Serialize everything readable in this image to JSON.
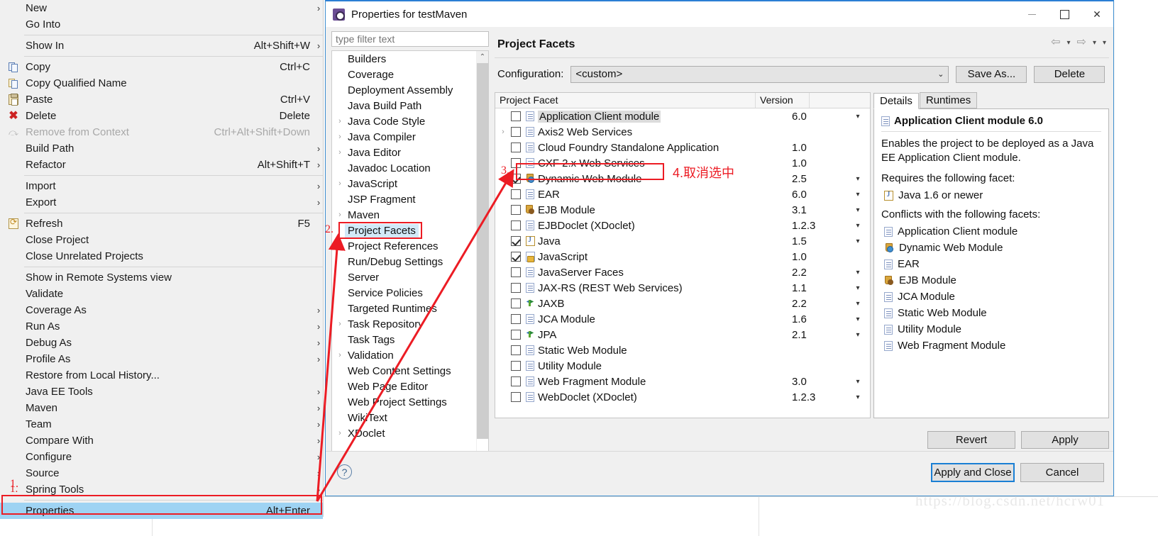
{
  "context_menu": {
    "groups": [
      {
        "items": [
          {
            "label": "New",
            "accel": "",
            "submenu": true,
            "icon": ""
          },
          {
            "label": "Go Into",
            "accel": "",
            "submenu": false,
            "icon": ""
          }
        ]
      },
      {
        "items": [
          {
            "label": "Show In",
            "accel": "Alt+Shift+W",
            "submenu": true,
            "icon": ""
          }
        ]
      },
      {
        "items": [
          {
            "label": "Copy",
            "accel": "Ctrl+C",
            "submenu": false,
            "icon": "copy-icon"
          },
          {
            "label": "Copy Qualified Name",
            "accel": "",
            "submenu": false,
            "icon": "copy-qualified-icon"
          },
          {
            "label": "Paste",
            "accel": "Ctrl+V",
            "submenu": false,
            "icon": "paste-icon"
          },
          {
            "label": "Delete",
            "accel": "Delete",
            "submenu": false,
            "icon": "delete-icon"
          },
          {
            "label": "Remove from Context",
            "accel": "Ctrl+Alt+Shift+Down",
            "submenu": false,
            "icon": "remove-context-icon",
            "disabled": true
          },
          {
            "label": "Build Path",
            "accel": "",
            "submenu": true,
            "icon": ""
          },
          {
            "label": "Refactor",
            "accel": "Alt+Shift+T",
            "submenu": true,
            "icon": ""
          }
        ]
      },
      {
        "items": [
          {
            "label": "Import",
            "accel": "",
            "submenu": true,
            "icon": ""
          },
          {
            "label": "Export",
            "accel": "",
            "submenu": true,
            "icon": ""
          }
        ]
      },
      {
        "items": [
          {
            "label": "Refresh",
            "accel": "F5",
            "submenu": false,
            "icon": "refresh-icon"
          },
          {
            "label": "Close Project",
            "accel": "",
            "submenu": false,
            "icon": ""
          },
          {
            "label": "Close Unrelated Projects",
            "accel": "",
            "submenu": false,
            "icon": ""
          }
        ]
      },
      {
        "items": [
          {
            "label": "Show in Remote Systems view",
            "accel": "",
            "submenu": false,
            "icon": ""
          },
          {
            "label": "Validate",
            "accel": "",
            "submenu": false,
            "icon": ""
          },
          {
            "label": "Coverage As",
            "accel": "",
            "submenu": true,
            "icon": ""
          },
          {
            "label": "Run As",
            "accel": "",
            "submenu": true,
            "icon": ""
          },
          {
            "label": "Debug As",
            "accel": "",
            "submenu": true,
            "icon": ""
          },
          {
            "label": "Profile As",
            "accel": "",
            "submenu": true,
            "icon": ""
          },
          {
            "label": "Restore from Local History...",
            "accel": "",
            "submenu": false,
            "icon": ""
          },
          {
            "label": "Java EE Tools",
            "accel": "",
            "submenu": true,
            "icon": ""
          },
          {
            "label": "Maven",
            "accel": "",
            "submenu": true,
            "icon": ""
          },
          {
            "label": "Team",
            "accel": "",
            "submenu": true,
            "icon": ""
          },
          {
            "label": "Compare With",
            "accel": "",
            "submenu": true,
            "icon": ""
          },
          {
            "label": "Configure",
            "accel": "",
            "submenu": true,
            "icon": ""
          },
          {
            "label": "Source",
            "accel": "",
            "submenu": true,
            "icon": ""
          },
          {
            "label": "Spring Tools",
            "accel": "",
            "submenu": true,
            "icon": "",
            "annotation": "1."
          }
        ]
      },
      {
        "items": [
          {
            "label": "Properties",
            "accel": "Alt+Enter",
            "submenu": false,
            "icon": "",
            "selected": true
          }
        ]
      }
    ]
  },
  "dialog": {
    "title": "Properties for testMaven",
    "window_controls": {
      "minimize": "−",
      "maximize": "□",
      "close": "✕"
    },
    "filter": {
      "placeholder": "type filter text",
      "value": ""
    },
    "tree": [
      {
        "label": "Builders",
        "expandable": false
      },
      {
        "label": "Coverage",
        "expandable": false
      },
      {
        "label": "Deployment Assembly",
        "expandable": false
      },
      {
        "label": "Java Build Path",
        "expandable": false
      },
      {
        "label": "Java Code Style",
        "expandable": true
      },
      {
        "label": "Java Compiler",
        "expandable": true
      },
      {
        "label": "Java Editor",
        "expandable": true
      },
      {
        "label": "Javadoc Location",
        "expandable": false
      },
      {
        "label": "JavaScript",
        "expandable": true
      },
      {
        "label": "JSP Fragment",
        "expandable": false
      },
      {
        "label": "Maven",
        "expandable": true
      },
      {
        "label": "Project Facets",
        "expandable": false,
        "selected": true,
        "annotation": "2."
      },
      {
        "label": "Project References",
        "expandable": false
      },
      {
        "label": "Run/Debug Settings",
        "expandable": false
      },
      {
        "label": "Server",
        "expandable": false
      },
      {
        "label": "Service Policies",
        "expandable": false
      },
      {
        "label": "Targeted Runtimes",
        "expandable": false
      },
      {
        "label": "Task Repository",
        "expandable": true
      },
      {
        "label": "Task Tags",
        "expandable": false
      },
      {
        "label": "Validation",
        "expandable": true
      },
      {
        "label": "Web Content Settings",
        "expandable": false
      },
      {
        "label": "Web Page Editor",
        "expandable": false
      },
      {
        "label": "Web Project Settings",
        "expandable": false
      },
      {
        "label": "WikiText",
        "expandable": false
      },
      {
        "label": "XDoclet",
        "expandable": true
      }
    ],
    "page": {
      "title": "Project Facets",
      "nav": {
        "back": "⇦",
        "back_menu": "▾",
        "forward": "⇨",
        "forward_menu": "▾",
        "view_menu": "▾"
      }
    },
    "configuration": {
      "label": "Configuration:",
      "value": "<custom>",
      "save_as_label": "Save As...",
      "delete_label": "Delete"
    },
    "facet_table": {
      "columns": [
        "Project Facet",
        "Version",
        ""
      ],
      "rows": [
        {
          "checked": false,
          "expandable": false,
          "icon": "doc-icon",
          "name": "Application Client module",
          "version": "6.0",
          "has_version_menu": true,
          "highlighted": true
        },
        {
          "checked": false,
          "expandable": true,
          "icon": "doc-icon",
          "name": "Axis2 Web Services",
          "version": "",
          "has_version_menu": false
        },
        {
          "checked": false,
          "expandable": false,
          "icon": "doc-icon",
          "name": "Cloud Foundry Standalone Application",
          "version": "1.0",
          "has_version_menu": false
        },
        {
          "checked": false,
          "expandable": false,
          "icon": "doc-icon",
          "name": "CXF 2.x Web Services",
          "version": "1.0",
          "has_version_menu": false
        },
        {
          "checked": true,
          "expandable": false,
          "icon": "web-module-icon",
          "name": "Dynamic Web Module",
          "version": "2.5",
          "has_version_menu": true,
          "annotation": "3."
        },
        {
          "checked": false,
          "expandable": false,
          "icon": "doc-icon",
          "name": "EAR",
          "version": "6.0",
          "has_version_menu": true
        },
        {
          "checked": false,
          "expandable": false,
          "icon": "ejb-module-icon",
          "name": "EJB Module",
          "version": "3.1",
          "has_version_menu": true
        },
        {
          "checked": false,
          "expandable": false,
          "icon": "doc-icon",
          "name": "EJBDoclet (XDoclet)",
          "version": "1.2.3",
          "has_version_menu": true
        },
        {
          "checked": true,
          "expandable": false,
          "icon": "java-icon",
          "name": "Java",
          "version": "1.5",
          "has_version_menu": true
        },
        {
          "checked": true,
          "expandable": false,
          "icon": "javascript-icon",
          "name": "JavaScript",
          "version": "1.0",
          "has_version_menu": false
        },
        {
          "checked": false,
          "expandable": false,
          "icon": "doc-icon",
          "name": "JavaServer Faces",
          "version": "2.2",
          "has_version_menu": true
        },
        {
          "checked": false,
          "expandable": false,
          "icon": "doc-icon",
          "name": "JAX-RS (REST Web Services)",
          "version": "1.1",
          "has_version_menu": true
        },
        {
          "checked": false,
          "expandable": false,
          "icon": "xml-icon",
          "name": "JAXB",
          "version": "2.2",
          "has_version_menu": true
        },
        {
          "checked": false,
          "expandable": false,
          "icon": "doc-icon",
          "name": "JCA Module",
          "version": "1.6",
          "has_version_menu": true
        },
        {
          "checked": false,
          "expandable": false,
          "icon": "xml-icon",
          "name": "JPA",
          "version": "2.1",
          "has_version_menu": true
        },
        {
          "checked": false,
          "expandable": false,
          "icon": "doc-icon",
          "name": "Static Web Module",
          "version": "",
          "has_version_menu": false
        },
        {
          "checked": false,
          "expandable": false,
          "icon": "doc-icon",
          "name": "Utility Module",
          "version": "",
          "has_version_menu": false
        },
        {
          "checked": false,
          "expandable": false,
          "icon": "doc-icon",
          "name": "Web Fragment Module",
          "version": "3.0",
          "has_version_menu": true
        },
        {
          "checked": false,
          "expandable": false,
          "icon": "doc-icon",
          "name": "WebDoclet (XDoclet)",
          "version": "1.2.3",
          "has_version_menu": true
        }
      ]
    },
    "details": {
      "tabs": [
        {
          "label": "Details",
          "active": true
        },
        {
          "label": "Runtimes",
          "active": false
        }
      ],
      "facet_title": "Application Client module 6.0",
      "facet_title_icon": "doc-icon",
      "description": "Enables the project to be deployed as a Java EE Application Client module.",
      "requires_label": "Requires the following facet:",
      "requires": [
        {
          "icon": "java-icon",
          "label": "Java 1.6 or newer"
        }
      ],
      "conflicts_label": "Conflicts with the following facets:",
      "conflicts": [
        {
          "icon": "doc-icon",
          "label": "Application Client module"
        },
        {
          "icon": "web-module-icon",
          "label": "Dynamic Web Module"
        },
        {
          "icon": "doc-icon",
          "label": "EAR"
        },
        {
          "icon": "ejb-module-icon",
          "label": "EJB Module"
        },
        {
          "icon": "doc-icon",
          "label": "JCA Module"
        },
        {
          "icon": "doc-icon",
          "label": "Static Web Module"
        },
        {
          "icon": "doc-icon",
          "label": "Utility Module"
        },
        {
          "icon": "doc-icon",
          "label": "Web Fragment Module"
        }
      ]
    },
    "actions": {
      "revert": "Revert",
      "apply": "Apply",
      "apply_and_close": "Apply and Close",
      "cancel": "Cancel",
      "help_icon": "?"
    }
  },
  "annotations": {
    "step1": "1.",
    "step2": "2.",
    "step3": "3.",
    "step4": "4.取消选中",
    "accent_color": "#ec1c24"
  },
  "watermark": "https://blog.csdn.net/hcrw01"
}
